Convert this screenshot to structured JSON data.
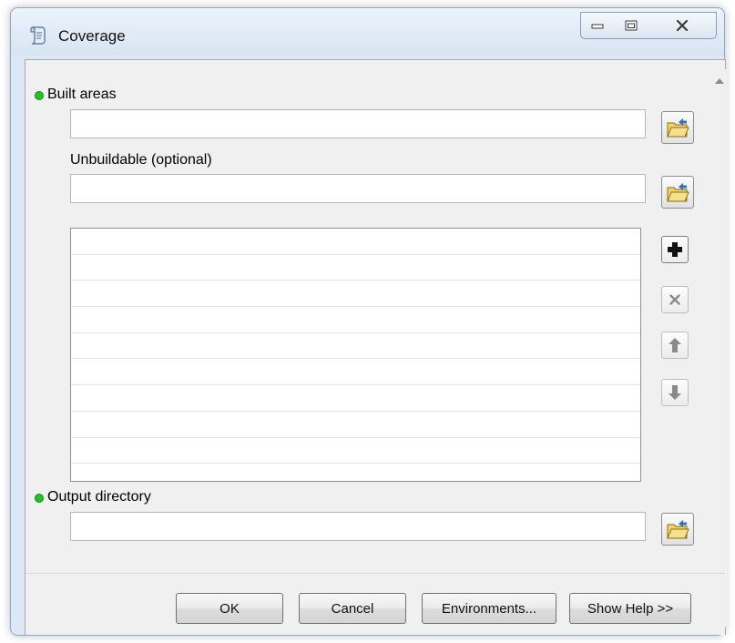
{
  "window": {
    "title": "Coverage",
    "icon": "script-tool-icon",
    "controls": [
      "minimize-icon",
      "maximize-icon",
      "close-icon"
    ]
  },
  "form": {
    "built_areas": {
      "label": "Built areas",
      "required": true,
      "value": ""
    },
    "unbuildable": {
      "label": "Unbuildable (optional)",
      "required": false,
      "value": ""
    },
    "unbuildable_list": {
      "items": [],
      "visible_rows": 10
    },
    "list_buttons": [
      "add-icon",
      "remove-icon",
      "move-up-icon",
      "move-down-icon"
    ],
    "output_directory": {
      "label": "Output directory",
      "required": true,
      "value": ""
    }
  },
  "footer": {
    "ok_label": "OK",
    "cancel_label": "Cancel",
    "environments_label": "Environments...",
    "show_help_label": "Show Help >>"
  },
  "colors": {
    "required_dot": "#22c422",
    "client_background": "#f0f0f0",
    "titlebar": "#dce8f5"
  }
}
